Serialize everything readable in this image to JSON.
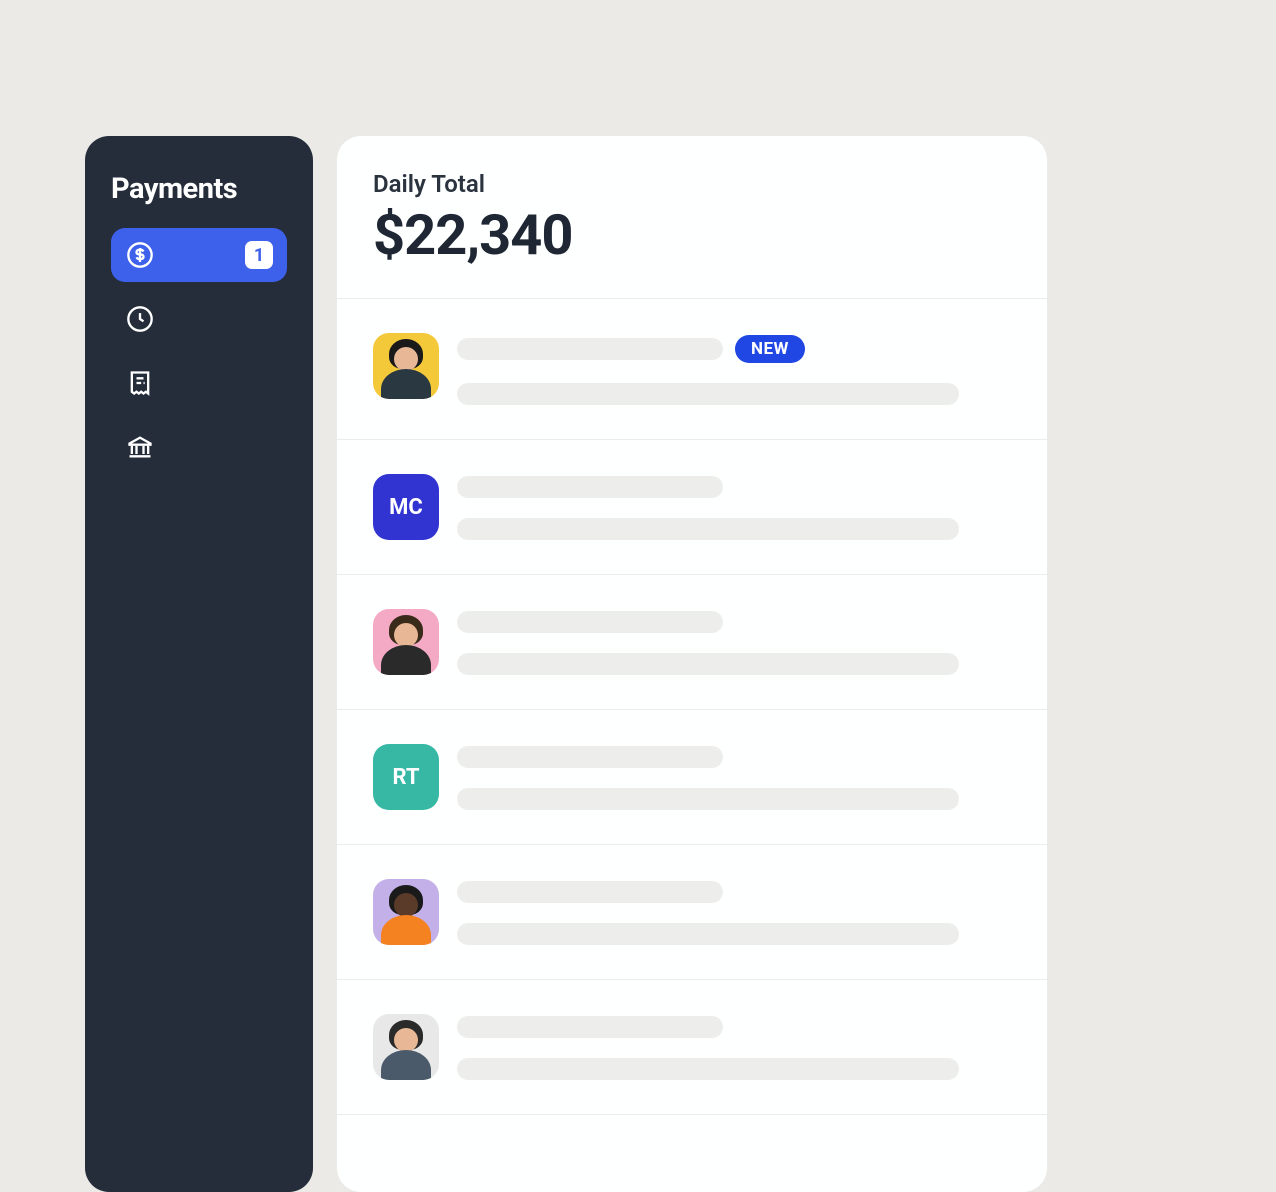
{
  "sidebar": {
    "title": "Payments",
    "items": [
      {
        "icon": "dollar-circle-icon",
        "badge": "1",
        "active": true
      },
      {
        "icon": "clock-icon"
      },
      {
        "icon": "receipt-icon"
      },
      {
        "icon": "bank-icon"
      }
    ]
  },
  "header": {
    "label": "Daily Total",
    "value": "$22,340"
  },
  "list": {
    "new_pill_label": "NEW",
    "items": [
      {
        "type": "photo",
        "avatar_class": "photo-1",
        "has_new": true,
        "head_color": "#e8b896",
        "body_color": "#2a3842",
        "hair_color": "#1a1a1a"
      },
      {
        "type": "initials",
        "avatar_class": "initials-mc",
        "initials": "MC"
      },
      {
        "type": "photo",
        "avatar_class": "photo-3",
        "head_color": "#e8b896",
        "body_color": "#2a2a2a",
        "hair_color": "#3a2a1a"
      },
      {
        "type": "initials",
        "avatar_class": "initials-rt",
        "initials": "RT"
      },
      {
        "type": "photo",
        "avatar_class": "photo-5",
        "head_color": "#5a3a28",
        "body_color": "#f58220",
        "hair_color": "#1a1a1a"
      },
      {
        "type": "photo",
        "avatar_class": "photo-6",
        "head_color": "#e8b896",
        "body_color": "#4a5a6a",
        "hair_color": "#2a2a2a"
      }
    ]
  }
}
